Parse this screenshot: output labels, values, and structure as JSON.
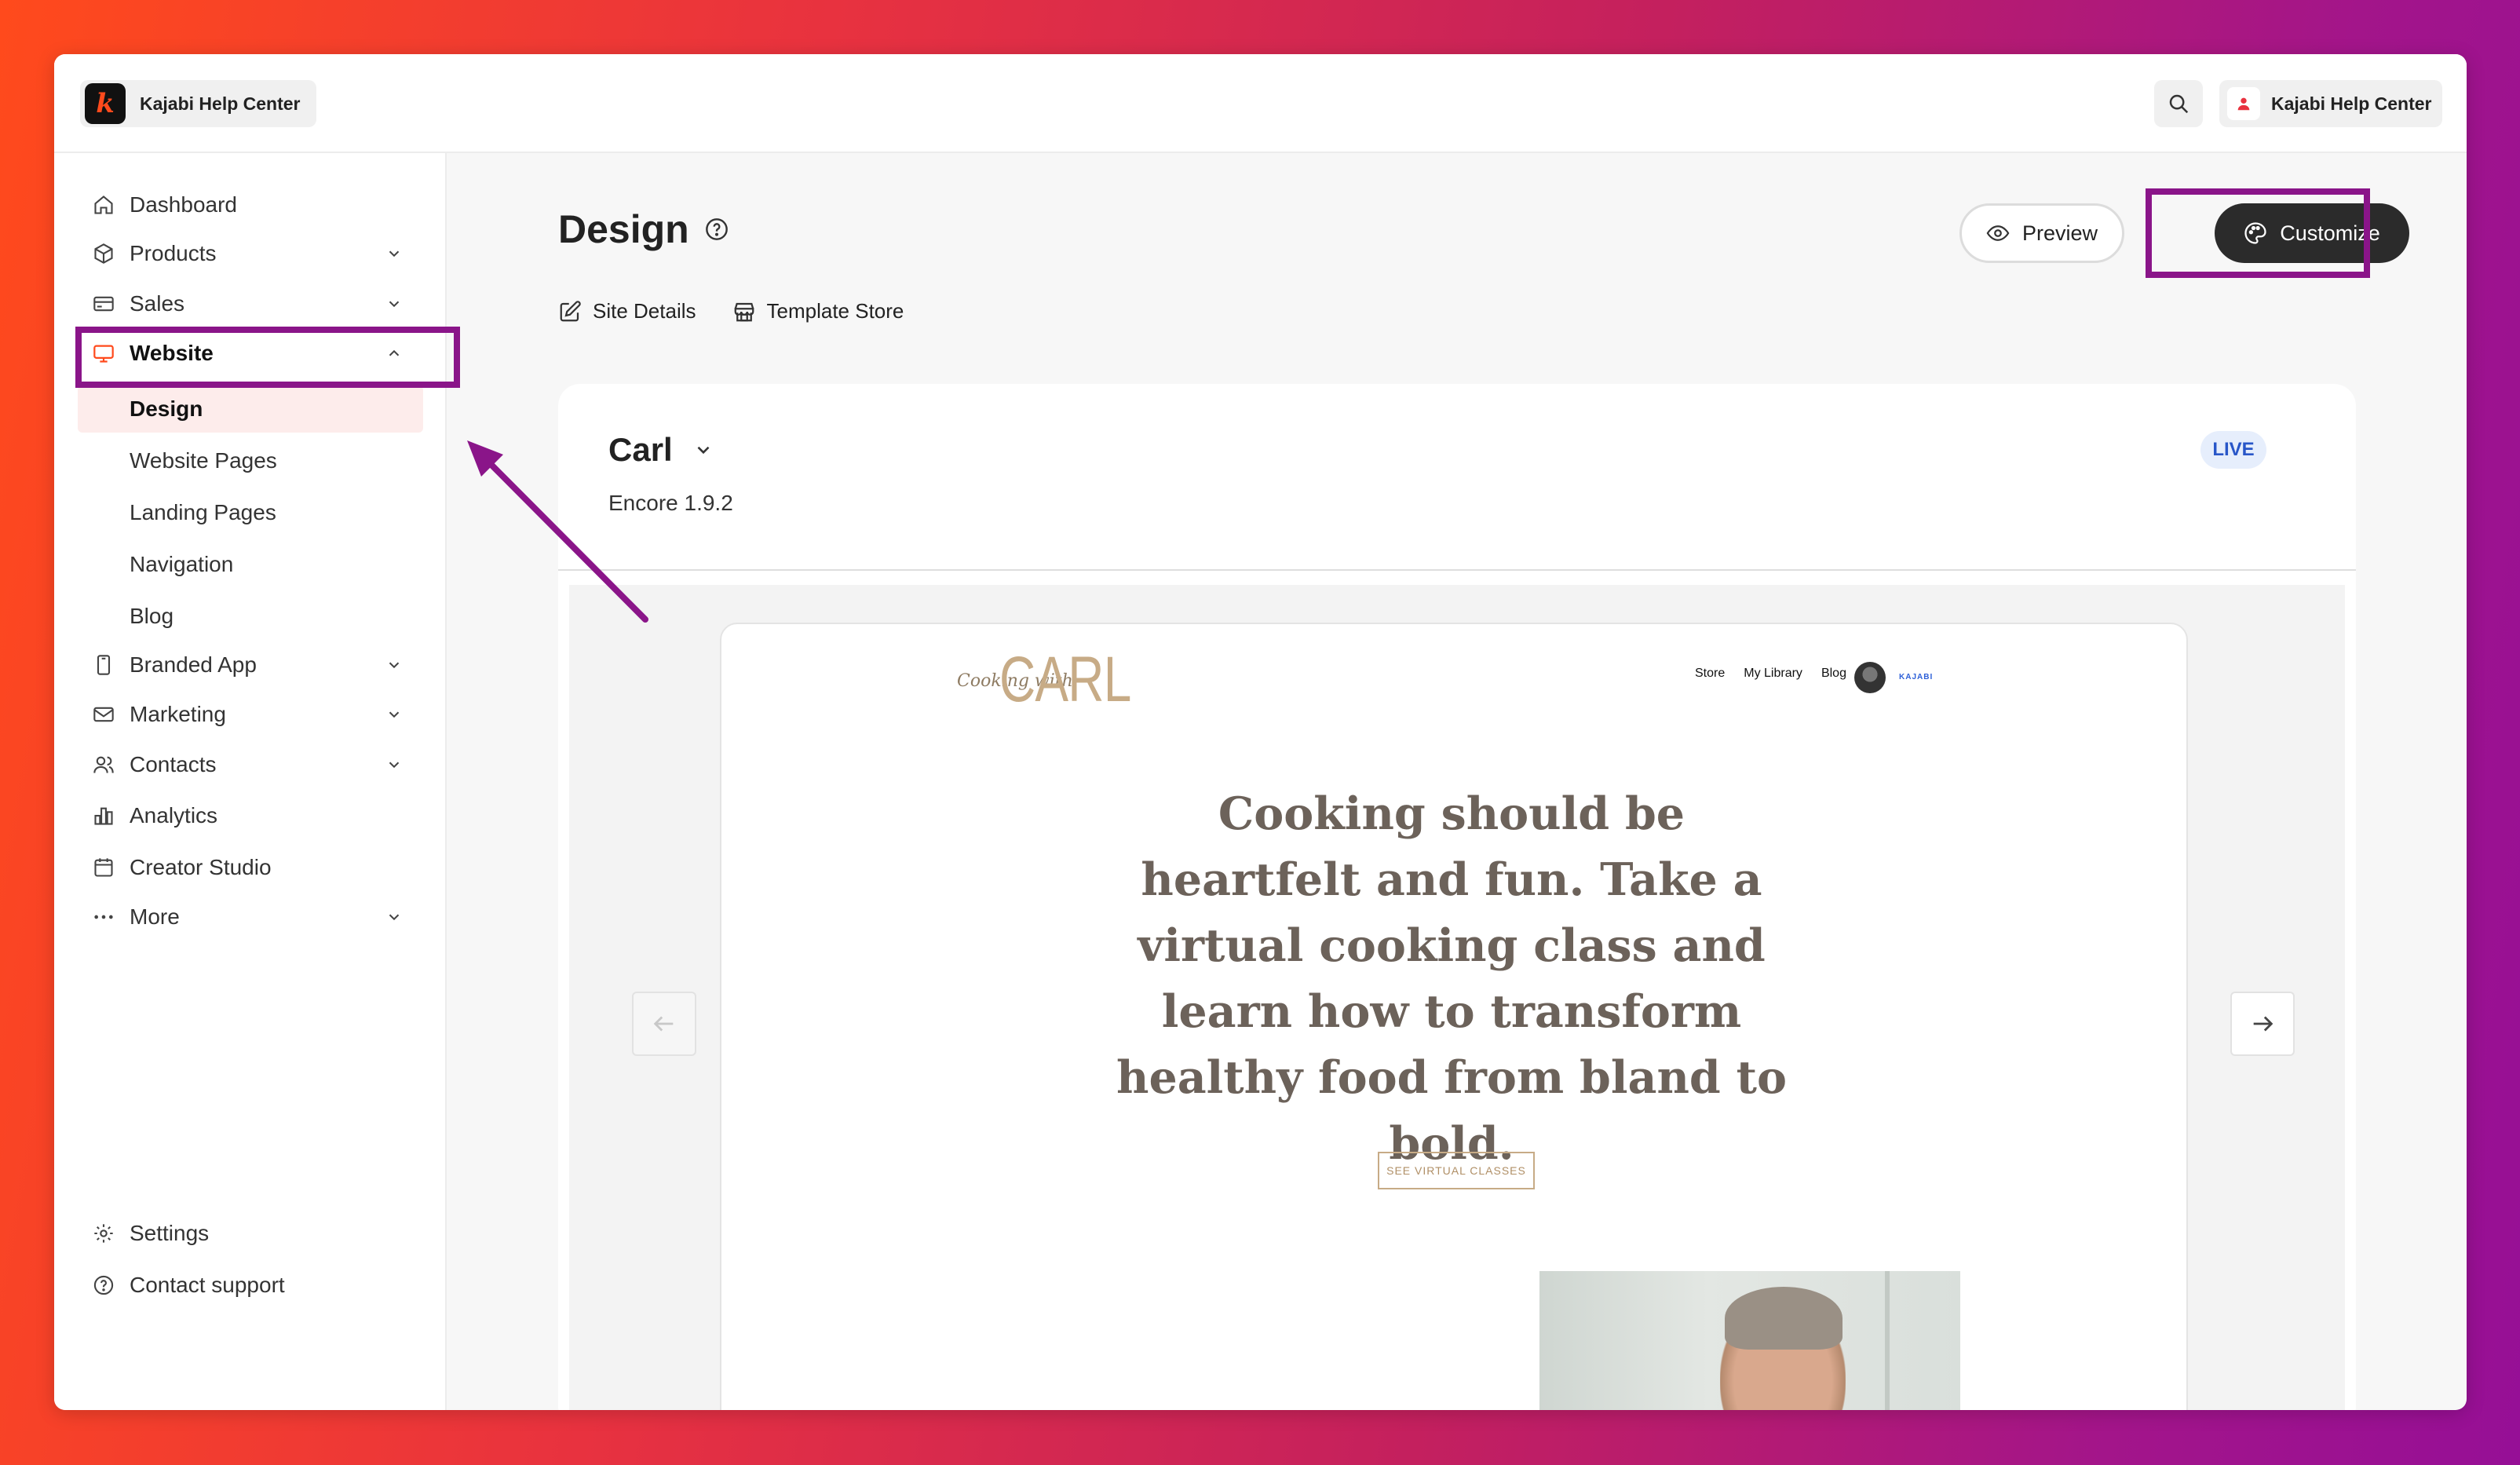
{
  "header": {
    "brand_name": "Kajabi Help Center",
    "brand_logo_letter": "k",
    "account_name": "Kajabi Help Center"
  },
  "sidebar": {
    "items": [
      {
        "label": "Dashboard",
        "icon": "home-icon"
      },
      {
        "label": "Products",
        "icon": "box-icon"
      },
      {
        "label": "Sales",
        "icon": "credit-card-icon"
      },
      {
        "label": "Website",
        "icon": "monitor-icon"
      },
      {
        "label": "Branded App",
        "icon": "phone-icon"
      },
      {
        "label": "Marketing",
        "icon": "mail-icon"
      },
      {
        "label": "Contacts",
        "icon": "users-icon"
      },
      {
        "label": "Analytics",
        "icon": "bar-chart-icon"
      },
      {
        "label": "Creator Studio",
        "icon": "calendar-icon"
      },
      {
        "label": "More",
        "icon": "more-dots-icon"
      }
    ],
    "website_sub_items": [
      "Design",
      "Website Pages",
      "Landing Pages",
      "Navigation",
      "Blog"
    ],
    "footer_items": [
      {
        "label": "Settings",
        "icon": "gear-icon"
      },
      {
        "label": "Contact support",
        "icon": "help-circle-icon"
      }
    ]
  },
  "main": {
    "title": "Design",
    "subnav": [
      "Site Details",
      "Template Store"
    ],
    "preview_label": "Preview",
    "customize_label": "Customize",
    "theme": {
      "name": "Carl",
      "version": "Encore 1.9.2",
      "status": "LIVE"
    },
    "site_preview": {
      "logo_script": "Cooking with",
      "logo": "CARL",
      "nav": [
        "Store",
        "My Library",
        "Blog"
      ],
      "powered_by": "KAJABI",
      "headline": "Cooking should be heartfelt and fun. Take a virtual cooking class and learn how to transform healthy food from bland to bold.",
      "cta": "SEE VIRTUAL CLASSES"
    }
  },
  "colors": {
    "highlight": "#8a1589",
    "accent": "#ff4a1c",
    "live_badge": "#2856c8"
  }
}
